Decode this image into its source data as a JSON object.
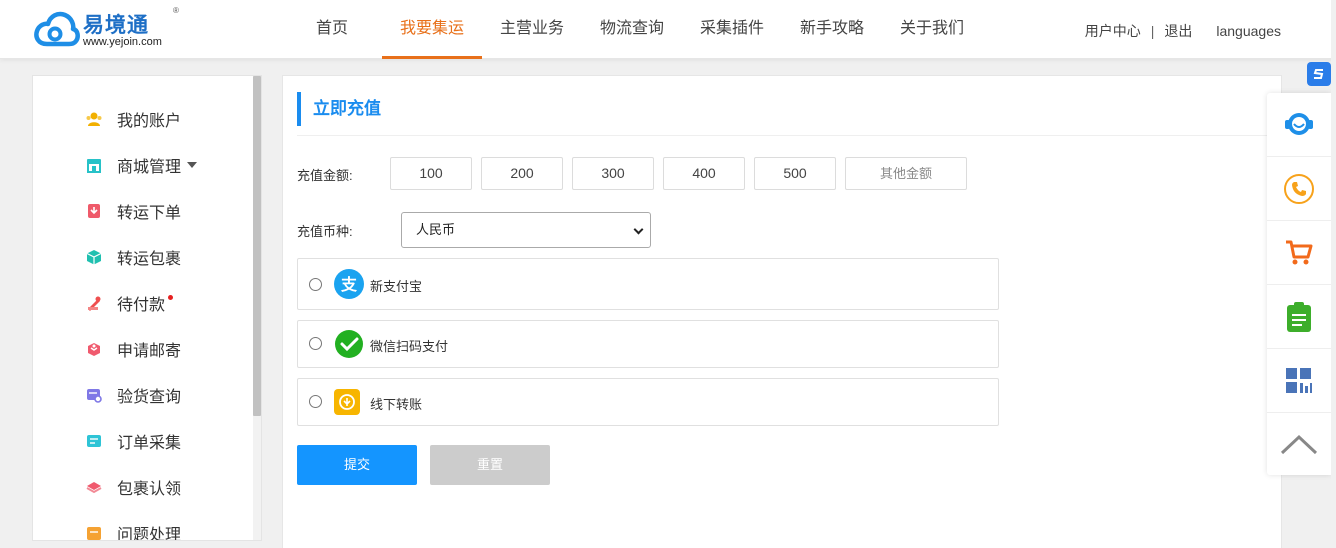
{
  "brand": {
    "name": "易境通",
    "reg": "®",
    "url": "www.yejoin.com",
    "accent": "#1e6fc6"
  },
  "nav": [
    {
      "label": "首页",
      "active": false
    },
    {
      "label": "我要集运",
      "active": true
    },
    {
      "label": "主营业务",
      "active": false
    },
    {
      "label": "物流查询",
      "active": false
    },
    {
      "label": "采集插件",
      "active": false
    },
    {
      "label": "新手攻略",
      "active": false
    },
    {
      "label": "关于我们",
      "active": false
    }
  ],
  "header_right": {
    "user_center": "用户中心",
    "separator": "|",
    "logout": "退出",
    "languages": "languages"
  },
  "sidebar": {
    "items": [
      {
        "label": "我的账户",
        "icon": "user-group-icon"
      },
      {
        "label": "商城管理",
        "icon": "store-icon"
      },
      {
        "label": "转运下单",
        "icon": "order-icon"
      },
      {
        "label": "转运包裹",
        "icon": "box-icon"
      },
      {
        "label": "待付款",
        "icon": "payment-icon"
      },
      {
        "label": "申请邮寄",
        "icon": "gift-icon"
      },
      {
        "label": "验货查询",
        "icon": "inspect-icon"
      },
      {
        "label": "订单采集",
        "icon": "collect-icon"
      },
      {
        "label": "包裹认领",
        "icon": "claim-icon"
      },
      {
        "label": "问题处理",
        "icon": "issue-icon"
      }
    ]
  },
  "recharge": {
    "title": "立即充值",
    "amount_label": "充值金额:",
    "amounts": [
      "100",
      "200",
      "300",
      "400",
      "500"
    ],
    "other_amount": "其他金额",
    "currency_label": "充值币种:",
    "currency_value": "人民币",
    "payment_methods": [
      {
        "label": "新支付宝",
        "icon": "alipay-icon"
      },
      {
        "label": "微信扫码支付",
        "icon": "wechat-pay-icon"
      },
      {
        "label": "线下转账",
        "icon": "offline-transfer-icon"
      }
    ],
    "submit_label": "提交",
    "reset_label": "重置"
  },
  "colors": {
    "accent_orange": "#e8701a",
    "primary_blue": "#1495ff",
    "title_blue": "#1a8cef"
  }
}
